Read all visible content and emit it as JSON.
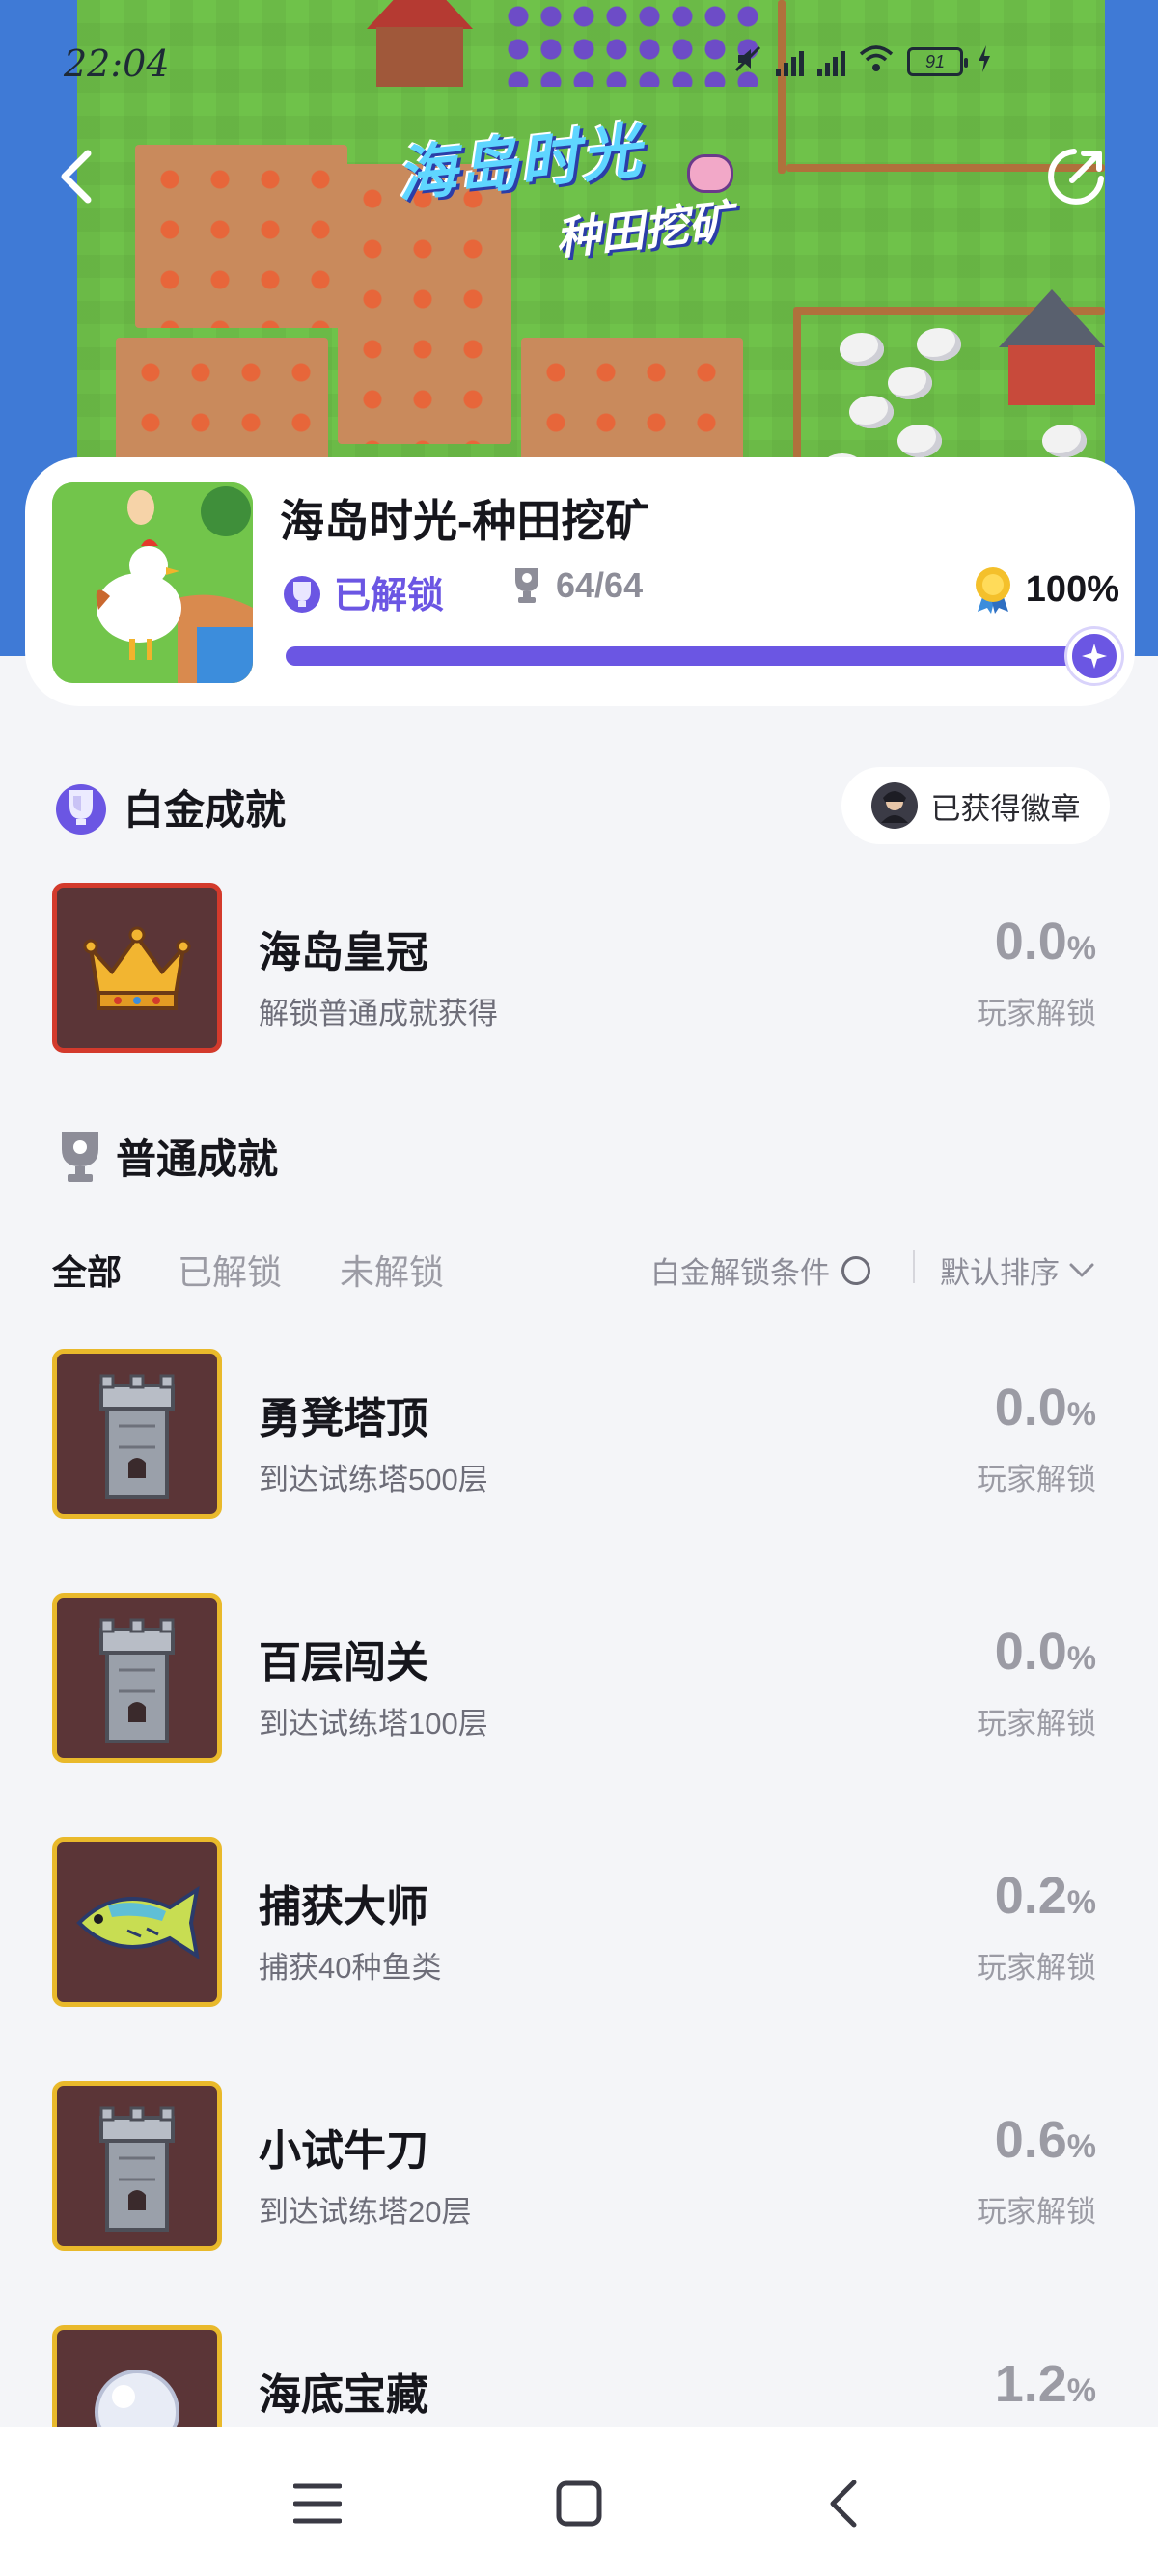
{
  "status_bar": {
    "time": "22:04",
    "battery": "91"
  },
  "banner": {
    "title": "海岛时光",
    "subtitle": "种田挖矿"
  },
  "game": {
    "name": "海岛时光-种田挖矿",
    "unlocked_label": "已解锁",
    "achievement_count": "64/64",
    "completion": "100%",
    "progress_fraction": 1.0
  },
  "platinum_section": {
    "title": "白金成就",
    "badge_button": "已获得徽章",
    "item": {
      "title": "海岛皇冠",
      "desc": "解锁普通成就获得",
      "rate": "0.0",
      "rate_unit": "%",
      "rate_label": "玩家解锁",
      "icon": "crown-icon"
    }
  },
  "normal_section": {
    "title": "普通成就",
    "tabs": [
      "全部",
      "已解锁",
      "未解锁"
    ],
    "active_tab": "全部",
    "platinum_condition": "白金解锁条件",
    "sort_label": "默认排序",
    "items": [
      {
        "title": "勇凳塔顶",
        "desc": "到达试练塔500层",
        "rate": "0.0",
        "rate_unit": "%",
        "rate_label": "玩家解锁",
        "icon": "tower-icon"
      },
      {
        "title": "百层闯关",
        "desc": "到达试练塔100层",
        "rate": "0.0",
        "rate_unit": "%",
        "rate_label": "玩家解锁",
        "icon": "tower-icon"
      },
      {
        "title": "捕获大师",
        "desc": "捕获40种鱼类",
        "rate": "0.2",
        "rate_unit": "%",
        "rate_label": "玩家解锁",
        "icon": "fish-icon"
      },
      {
        "title": "小试牛刀",
        "desc": "到达试练塔20层",
        "rate": "0.6",
        "rate_unit": "%",
        "rate_label": "玩家解锁",
        "icon": "tower-icon"
      },
      {
        "title": "海底宝藏",
        "desc": "",
        "rate": "1.2",
        "rate_unit": "%",
        "rate_label": "",
        "icon": "pearl-icon"
      }
    ]
  },
  "colors": {
    "accent": "#6b56e3",
    "background": "#f4f5f8",
    "card": "#ffffff",
    "icon_bg": "#5b3537",
    "gold_frame": "#e9b92b",
    "red_frame": "#d33a2c"
  }
}
